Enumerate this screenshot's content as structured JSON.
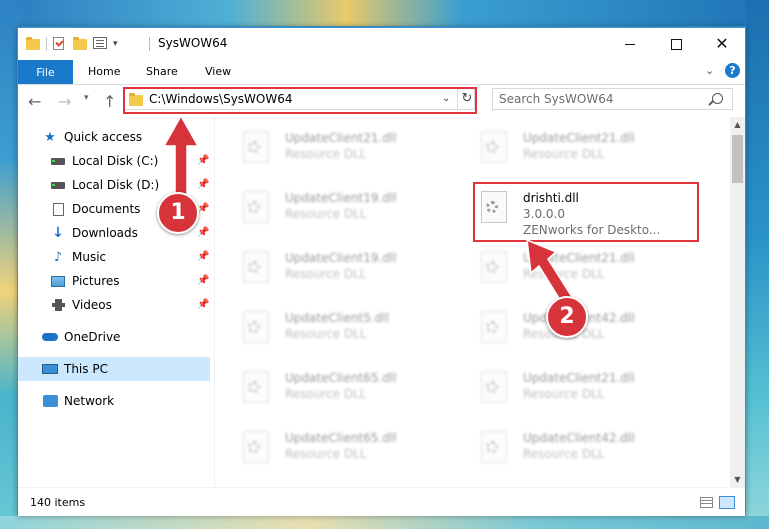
{
  "window": {
    "title": "SysWOW64",
    "controls": {
      "minimize_icon": "minimize-icon",
      "maximize_icon": "maximize-icon",
      "close_icon": "close-icon"
    }
  },
  "ribbon": {
    "tabs": [
      {
        "label": "File",
        "active": true
      },
      {
        "label": "Home"
      },
      {
        "label": "Share"
      },
      {
        "label": "View"
      }
    ],
    "help": "?",
    "accent": "#1979ca"
  },
  "navbar": {
    "address": "C:\\Windows\\SysWOW64",
    "search_placeholder": "Search SysWOW64"
  },
  "sidebar": {
    "items": [
      {
        "label": "Quick access",
        "icon": "star-icon"
      },
      {
        "label": "Local Disk (C:)",
        "icon": "disk-icon",
        "pinned": true
      },
      {
        "label": "Local Disk (D:)",
        "icon": "disk-icon",
        "pinned": true
      },
      {
        "label": "Documents",
        "icon": "document-icon",
        "pinned": true
      },
      {
        "label": "Downloads",
        "icon": "download-icon",
        "pinned": true
      },
      {
        "label": "Music",
        "icon": "music-icon",
        "pinned": true
      },
      {
        "label": "Pictures",
        "icon": "pictures-icon",
        "pinned": true
      },
      {
        "label": "Videos",
        "icon": "videos-icon",
        "pinned": true
      },
      {
        "label": "OneDrive",
        "icon": "cloud-icon"
      },
      {
        "label": "This PC",
        "icon": "computer-icon",
        "selected": true
      },
      {
        "label": "Network",
        "icon": "network-icon"
      }
    ]
  },
  "files": {
    "left": [
      {
        "name": "UpdateClient21.dll",
        "type": "Resource DLL"
      },
      {
        "name": "UpdateClient19.dll",
        "type": "Resource DLL"
      },
      {
        "name": "UpdateClient19.dll",
        "type": "Resource DLL"
      },
      {
        "name": "UpdateClient5.dll",
        "type": "Resource DLL"
      },
      {
        "name": "UpdateClient65.dll",
        "type": "Resource DLL"
      },
      {
        "name": "UpdateClient65.dll",
        "type": "Resource DLL"
      }
    ],
    "right": [
      {
        "name": "UpdateClient21.dll",
        "type": "Resource DLL"
      },
      {
        "name": "UpdateClient21.dll",
        "type": "Resource DLL"
      },
      {
        "name": "UpdateClient42.dll",
        "type": "Resource DLL"
      },
      {
        "name": "UpdateClient21.dll",
        "type": "Resource DLL"
      },
      {
        "name": "UpdateClient42.dll",
        "type": "Resource DLL"
      }
    ],
    "highlighted": {
      "name": "drishti.dll",
      "version": "3.0.0.0",
      "description": "ZENworks for Deskto..."
    }
  },
  "status": {
    "item_count": "140 items"
  },
  "annotations": {
    "callout_1": "1",
    "callout_2": "2",
    "color": "#e0333a"
  }
}
